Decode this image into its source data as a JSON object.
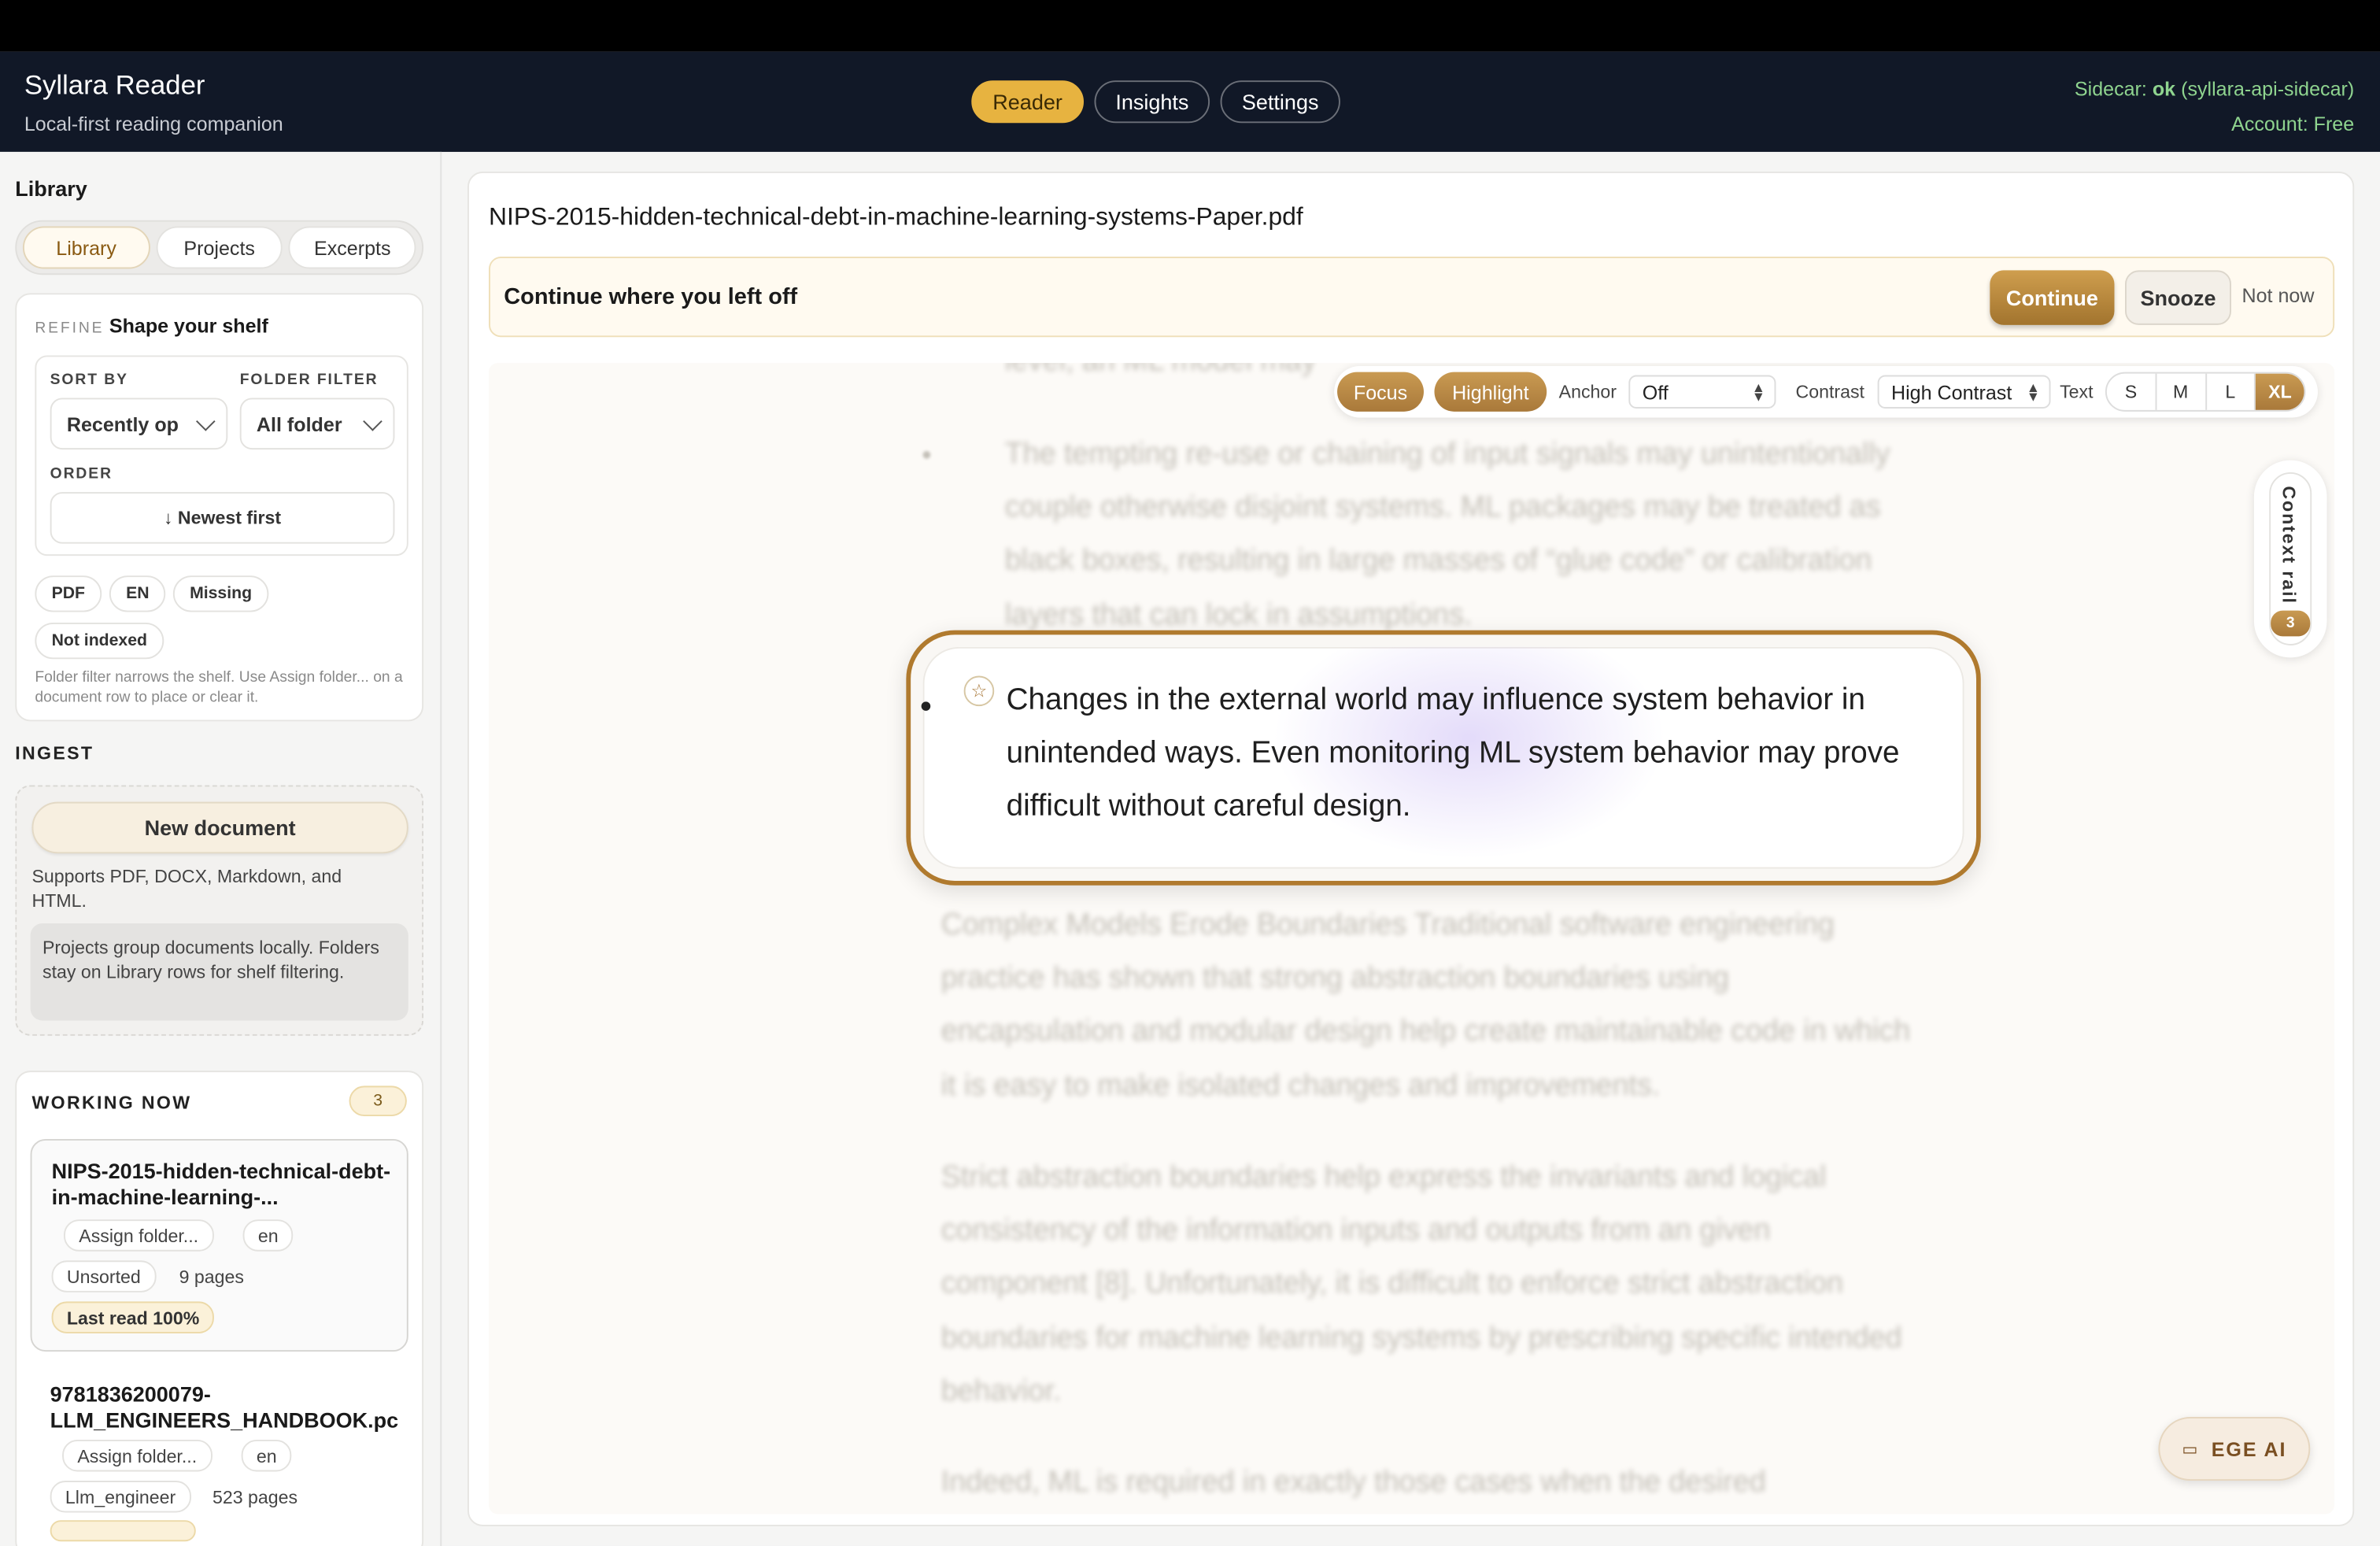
{
  "header": {
    "app_title": "Syllara Reader",
    "app_subtitle": "Local-first reading companion",
    "nav": [
      {
        "label": "Reader",
        "active": true
      },
      {
        "label": "Insights",
        "active": false
      },
      {
        "label": "Settings",
        "active": false
      }
    ],
    "sidecar_prefix": "Sidecar: ",
    "sidecar_status": "ok",
    "sidecar_name": " (syllara-api-sidecar)",
    "account": "Account: Free"
  },
  "sidebar": {
    "title": "Library",
    "segments": [
      {
        "label": "Library",
        "active": true
      },
      {
        "label": "Projects",
        "active": false
      },
      {
        "label": "Excerpts",
        "active": false
      }
    ],
    "refine": {
      "tag": "REFINE",
      "title": "Shape your shelf",
      "sort_by_label": "SORT BY",
      "sort_by_value": "Recently op",
      "folder_filter_label": "FOLDER FILTER",
      "folder_filter_value": "All folder",
      "order_label": "ORDER",
      "order_value": "↓  Newest first",
      "chips": [
        "PDF",
        "EN",
        "Missing",
        "Not indexed"
      ],
      "note": "Folder filter narrows the shelf. Use Assign folder... on a document row to place or clear it."
    },
    "ingest": {
      "title": "INGEST",
      "new_document": "New document",
      "supports": "Supports PDF, DOCX, Markdown, and HTML.",
      "projects_note": "Projects group documents locally. Folders stay on Library rows for shelf filtering."
    },
    "working_now": {
      "title": "WORKING NOW",
      "count": "3",
      "docs": [
        {
          "name": "NIPS-2015-hidden-technical-debt-in-machine-learning-...",
          "assign": "Assign folder...",
          "lang": "en",
          "folder": "Unsorted",
          "pages": "9 pages",
          "last_read": "Last read 100%"
        },
        {
          "name": "9781836200079-LLM_ENGINEERS_HANDBOOK.pc",
          "assign": "Assign folder...",
          "lang": "en",
          "folder": "Llm_engineer",
          "pages": "523 pages"
        }
      ]
    }
  },
  "main": {
    "doc_title": "NIPS-2015-hidden-technical-debt-in-machine-learning-systems-Paper.pdf",
    "continue_bar": {
      "text": "Continue where you left off",
      "continue": "Continue",
      "snooze": "Snooze",
      "not_now": "Not now"
    },
    "toolbar": {
      "focus": "Focus",
      "highlight": "Highlight",
      "anchor_label": "Anchor",
      "anchor_value": "Off",
      "contrast_label": "Contrast",
      "contrast_value": "High Contrast",
      "text_label": "Text",
      "sizes": [
        "S",
        "M",
        "L",
        "XL"
      ],
      "active_size": "XL"
    },
    "reader": {
      "above_fragment": "level, an ML model may",
      "above_bullet": "The tempting re-use or chaining of input signals may unintentionally couple otherwise disjoint systems. ML packages may be treated as black boxes, resulting in large masses of “glue code” or calibration layers that can lock in assumptions.",
      "focus_sentence": "Changes in the external world may influence system behavior in unintended ways. Even monitoring ML system behavior may prove difficult without careful design.",
      "para1": "Complex Models Erode Boundaries Traditional software engineering practice has shown that strong abstraction boundaries using encapsulation and modular design help create maintainable code in which it is easy to make isolated changes and improvements.",
      "para2": "Strict abstraction boundaries help express the invariants and logical consistency of the information inputs and outputs from an given component [8]. Unfortunately, it is difficult to enforce strict abstraction boundaries for machine learning systems by prescribing specific intended behavior.",
      "para3": "Indeed, ML is required in exactly those cases when the desired"
    },
    "context_rail": {
      "label": "Context rail",
      "count": "3"
    },
    "ai_button": "EGE AI"
  }
}
